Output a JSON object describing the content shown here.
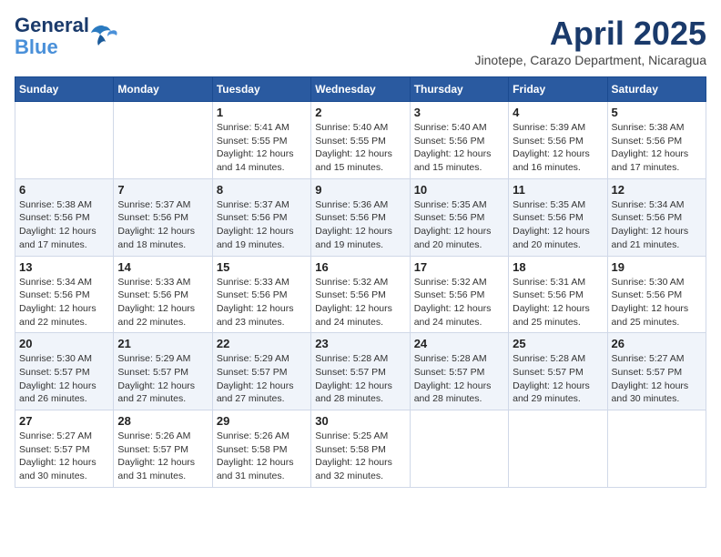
{
  "header": {
    "logo_line1": "General",
    "logo_line2": "Blue",
    "month_year": "April 2025",
    "location": "Jinotepe, Carazo Department, Nicaragua"
  },
  "days_of_week": [
    "Sunday",
    "Monday",
    "Tuesday",
    "Wednesday",
    "Thursday",
    "Friday",
    "Saturday"
  ],
  "weeks": [
    [
      {
        "day": "",
        "info": ""
      },
      {
        "day": "",
        "info": ""
      },
      {
        "day": "1",
        "info": "Sunrise: 5:41 AM\nSunset: 5:55 PM\nDaylight: 12 hours\nand 14 minutes."
      },
      {
        "day": "2",
        "info": "Sunrise: 5:40 AM\nSunset: 5:55 PM\nDaylight: 12 hours\nand 15 minutes."
      },
      {
        "day": "3",
        "info": "Sunrise: 5:40 AM\nSunset: 5:56 PM\nDaylight: 12 hours\nand 15 minutes."
      },
      {
        "day": "4",
        "info": "Sunrise: 5:39 AM\nSunset: 5:56 PM\nDaylight: 12 hours\nand 16 minutes."
      },
      {
        "day": "5",
        "info": "Sunrise: 5:38 AM\nSunset: 5:56 PM\nDaylight: 12 hours\nand 17 minutes."
      }
    ],
    [
      {
        "day": "6",
        "info": "Sunrise: 5:38 AM\nSunset: 5:56 PM\nDaylight: 12 hours\nand 17 minutes."
      },
      {
        "day": "7",
        "info": "Sunrise: 5:37 AM\nSunset: 5:56 PM\nDaylight: 12 hours\nand 18 minutes."
      },
      {
        "day": "8",
        "info": "Sunrise: 5:37 AM\nSunset: 5:56 PM\nDaylight: 12 hours\nand 19 minutes."
      },
      {
        "day": "9",
        "info": "Sunrise: 5:36 AM\nSunset: 5:56 PM\nDaylight: 12 hours\nand 19 minutes."
      },
      {
        "day": "10",
        "info": "Sunrise: 5:35 AM\nSunset: 5:56 PM\nDaylight: 12 hours\nand 20 minutes."
      },
      {
        "day": "11",
        "info": "Sunrise: 5:35 AM\nSunset: 5:56 PM\nDaylight: 12 hours\nand 20 minutes."
      },
      {
        "day": "12",
        "info": "Sunrise: 5:34 AM\nSunset: 5:56 PM\nDaylight: 12 hours\nand 21 minutes."
      }
    ],
    [
      {
        "day": "13",
        "info": "Sunrise: 5:34 AM\nSunset: 5:56 PM\nDaylight: 12 hours\nand 22 minutes."
      },
      {
        "day": "14",
        "info": "Sunrise: 5:33 AM\nSunset: 5:56 PM\nDaylight: 12 hours\nand 22 minutes."
      },
      {
        "day": "15",
        "info": "Sunrise: 5:33 AM\nSunset: 5:56 PM\nDaylight: 12 hours\nand 23 minutes."
      },
      {
        "day": "16",
        "info": "Sunrise: 5:32 AM\nSunset: 5:56 PM\nDaylight: 12 hours\nand 24 minutes."
      },
      {
        "day": "17",
        "info": "Sunrise: 5:32 AM\nSunset: 5:56 PM\nDaylight: 12 hours\nand 24 minutes."
      },
      {
        "day": "18",
        "info": "Sunrise: 5:31 AM\nSunset: 5:56 PM\nDaylight: 12 hours\nand 25 minutes."
      },
      {
        "day": "19",
        "info": "Sunrise: 5:30 AM\nSunset: 5:56 PM\nDaylight: 12 hours\nand 25 minutes."
      }
    ],
    [
      {
        "day": "20",
        "info": "Sunrise: 5:30 AM\nSunset: 5:57 PM\nDaylight: 12 hours\nand 26 minutes."
      },
      {
        "day": "21",
        "info": "Sunrise: 5:29 AM\nSunset: 5:57 PM\nDaylight: 12 hours\nand 27 minutes."
      },
      {
        "day": "22",
        "info": "Sunrise: 5:29 AM\nSunset: 5:57 PM\nDaylight: 12 hours\nand 27 minutes."
      },
      {
        "day": "23",
        "info": "Sunrise: 5:28 AM\nSunset: 5:57 PM\nDaylight: 12 hours\nand 28 minutes."
      },
      {
        "day": "24",
        "info": "Sunrise: 5:28 AM\nSunset: 5:57 PM\nDaylight: 12 hours\nand 28 minutes."
      },
      {
        "day": "25",
        "info": "Sunrise: 5:28 AM\nSunset: 5:57 PM\nDaylight: 12 hours\nand 29 minutes."
      },
      {
        "day": "26",
        "info": "Sunrise: 5:27 AM\nSunset: 5:57 PM\nDaylight: 12 hours\nand 30 minutes."
      }
    ],
    [
      {
        "day": "27",
        "info": "Sunrise: 5:27 AM\nSunset: 5:57 PM\nDaylight: 12 hours\nand 30 minutes."
      },
      {
        "day": "28",
        "info": "Sunrise: 5:26 AM\nSunset: 5:57 PM\nDaylight: 12 hours\nand 31 minutes."
      },
      {
        "day": "29",
        "info": "Sunrise: 5:26 AM\nSunset: 5:58 PM\nDaylight: 12 hours\nand 31 minutes."
      },
      {
        "day": "30",
        "info": "Sunrise: 5:25 AM\nSunset: 5:58 PM\nDaylight: 12 hours\nand 32 minutes."
      },
      {
        "day": "",
        "info": ""
      },
      {
        "day": "",
        "info": ""
      },
      {
        "day": "",
        "info": ""
      }
    ]
  ]
}
